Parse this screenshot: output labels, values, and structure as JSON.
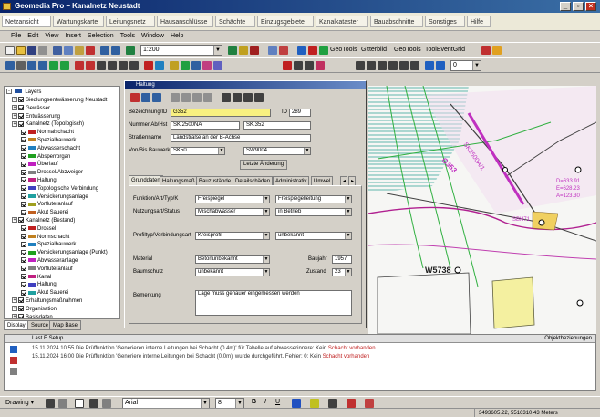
{
  "app": {
    "title": "Geomedia Pro – Kanalnetz Neustadt",
    "window_buttons": [
      "_",
      "▫",
      "×"
    ],
    "tabs": [
      "Netzansicht",
      "Wartungskarte",
      "Leitungsnetz",
      "Hausanschlüsse",
      "Schächte",
      "Einzugsgebiete",
      "Kanalkataster",
      "Bauabschnitte",
      "Sonstiges",
      "Hilfe"
    ]
  },
  "menu": [
    "File",
    "Edit",
    "View",
    "Insert",
    "Selection",
    "Tools",
    "Window",
    "Help"
  ],
  "toolbar": {
    "scale_value": "1:200",
    "labels": [
      "GeoTools",
      "Gitterbild",
      "GeoTools",
      "ToolEventGrid"
    ],
    "layer_combo": "0"
  },
  "toc": {
    "root": "Layers",
    "items": [
      {
        "label": "Siedlungsentwässerung Neustadt",
        "level": 1,
        "color": "#5060a0"
      },
      {
        "label": "Gewässer",
        "level": 1,
        "color": "#2060c0"
      },
      {
        "label": "Entwässerung",
        "level": 1,
        "color": "#406080"
      },
      {
        "label": "Kanalnetz (Topologisch)",
        "level": 1,
        "color": "#606060"
      },
      {
        "label": "Normalschacht",
        "level": 2,
        "color": "#c02020"
      },
      {
        "label": "Spezialbauwerk",
        "level": 2,
        "color": "#c08020"
      },
      {
        "label": "Abwasserschacht",
        "level": 2,
        "color": "#2080c0"
      },
      {
        "label": "Absperrorgan",
        "level": 2,
        "color": "#20a020"
      },
      {
        "label": "Überlauf",
        "level": 2,
        "color": "#c020c0"
      },
      {
        "label": "Drossel/Abzweiger",
        "level": 2,
        "color": "#808080"
      },
      {
        "label": "Haltung",
        "level": 2,
        "color": "#c02080"
      },
      {
        "label": "Topologische Verbindung",
        "level": 2,
        "color": "#4040c0"
      },
      {
        "label": "Versickerungsanlage",
        "level": 2,
        "color": "#20a0a0"
      },
      {
        "label": "Vorfluteranlauf",
        "level": 2,
        "color": "#a0a020"
      },
      {
        "label": "Akut Sauerei",
        "level": 2,
        "color": "#c06020"
      },
      {
        "label": "Kanalnetz (Bestand)",
        "level": 1,
        "color": "#606060"
      },
      {
        "label": "Drossel",
        "level": 2,
        "color": "#c02020"
      },
      {
        "label": "Normschacht",
        "level": 2,
        "color": "#c08020"
      },
      {
        "label": "Spezialbauwerk",
        "level": 2,
        "color": "#2080c0"
      },
      {
        "label": "Versickerungsanlage (Punkt)",
        "level": 2,
        "color": "#20a020"
      },
      {
        "label": "Abwasseranlage",
        "level": 2,
        "color": "#c020c0"
      },
      {
        "label": "Vorfluteranlauf",
        "level": 2,
        "color": "#808080"
      },
      {
        "label": "Kanal",
        "level": 2,
        "color": "#c02080"
      },
      {
        "label": "Haltung",
        "level": 2,
        "color": "#4040c0"
      },
      {
        "label": "Akut Sauerei",
        "level": 2,
        "color": "#20a0a0"
      },
      {
        "label": "Erhaltungsmaßnahmen",
        "level": 1,
        "color": "#606060"
      },
      {
        "label": "Organisation",
        "level": 1,
        "color": "#606060"
      },
      {
        "label": "Basisdaten",
        "level": 1,
        "color": "#606060"
      }
    ],
    "tabs": [
      "Display",
      "Source",
      "Map Base"
    ]
  },
  "dialog": {
    "title": "Haltung",
    "fields": {
      "bezeichnung_label": "Bezeichnung/ID",
      "bezeichnung_value": "G352",
      "id_label": "ID",
      "id_value": "289",
      "nummer_label": "Nummer Ab/Hst",
      "nummer_value1": "SK.2500NA",
      "nummer_value2": "SK.352",
      "strasse_label": "Straßenname",
      "strasse_value": "Landstraße an der B-Achse",
      "von_label": "Von/Bis Bauwerk",
      "von_value": "SK50",
      "bis_value": "SW9004",
      "last_change_button": "Letzte Änderung"
    },
    "tabs": [
      "Grunddaten",
      "Haltungsmaß",
      "Bauzustände",
      "Detailschäden",
      "Administrativ",
      "Umwel"
    ],
    "grunddaten": {
      "funktion_label": "Funktion/Art/Typ/K",
      "funktion_value": "Freispiegel",
      "funktion_value2": "Freispiegelleitung",
      "nutzung_label": "Nutzungsart/Status",
      "nutzung_value": "Mischabwasser",
      "nutzung_value2": "in Betrieb",
      "profil_label": "Profiltyp/Verbindungsart",
      "profil_value": "Kreisprofil",
      "profil_value2": "unbekannt",
      "material_label": "Material",
      "material_value": "Betonunbekannt",
      "baujahr_label": "Baujahr",
      "baujahr_value": "1957",
      "kanalschutz_label": "Baumschutz",
      "kanalschutz_value": "unbekannt",
      "zustand_label": "Zustand",
      "zustand_value": "23",
      "bemerkung_label": "Bemerkung",
      "bemerkung_value": "Lage muss genauer eingemessen werden"
    }
  },
  "map": {
    "labels": [
      "W5738",
      "G353",
      "SK2500A/1",
      "D=633.91",
      "E=628.23",
      "A=123.30",
      "SBH71"
    ]
  },
  "log": {
    "header_left": "Last  E  Setup",
    "header_right": "Objektbeziehungen",
    "lines": [
      {
        "date": "15.11.2024",
        "time": "10:55",
        "text": "Die Prüffunktion 'Generieren interne Leitungen bei Schacht (0.4m)' für Tabelle auf abwasserinnere: Kein",
        "error": "Schacht vorhanden"
      },
      {
        "date": "15.11.2024",
        "time": "16:00",
        "text": "Die Prüffunktion 'Generiere interne Leitungen bei Schacht (0.0m)' wurde durchgeführt. Fehler: 0: Kein",
        "error": "Schacht vorhanden"
      }
    ]
  },
  "drawbar": {
    "draw_label": "Drawing ▾",
    "font_name": "Arial",
    "font_size": "8"
  },
  "status": {
    "coords": "3493605.22, 5516310.43 Meters"
  }
}
